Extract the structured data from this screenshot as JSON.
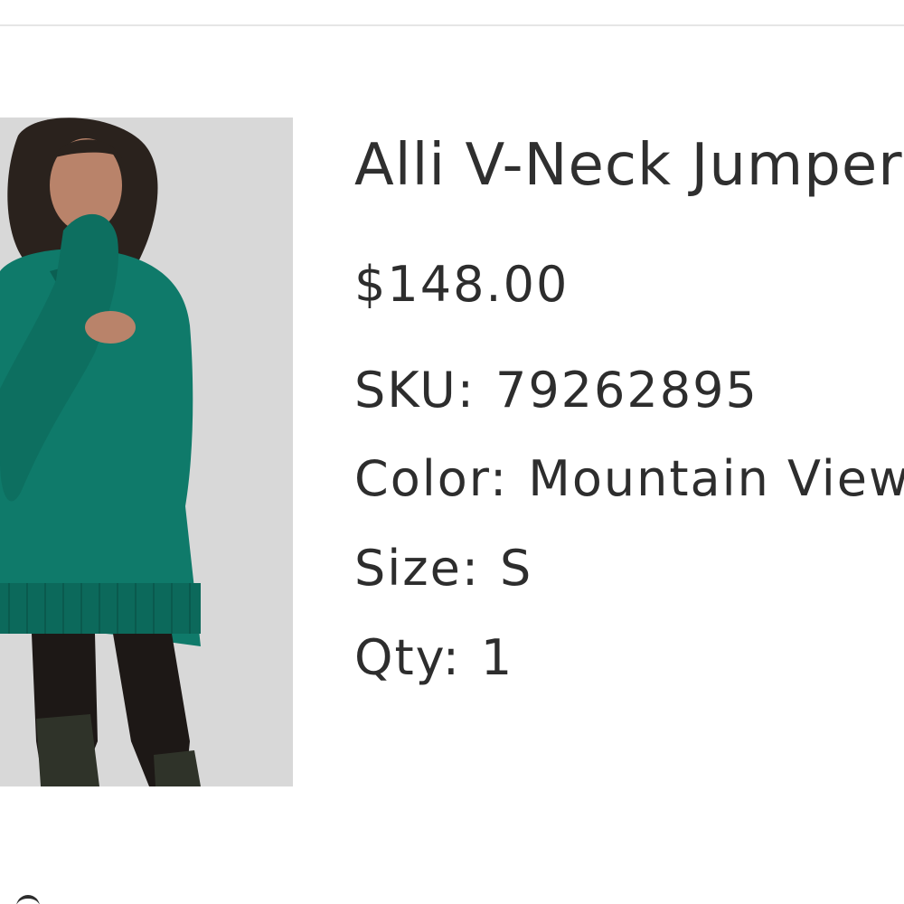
{
  "product": {
    "title": "Alli V-Neck Jumper",
    "price": "$148.00",
    "sku_label": "SKU:",
    "sku_value": "79262895",
    "color_label": "Color:",
    "color_value": "Mountain View",
    "size_label": "Size:",
    "size_value": "S",
    "qty_label": "Qty:",
    "qty_value": "1"
  },
  "image": {
    "subject": "model in teal oversized v-neck sweater, black tights and dark boots",
    "sweater_color": "#0f7a6a",
    "background_color": "#d8d8d8"
  }
}
